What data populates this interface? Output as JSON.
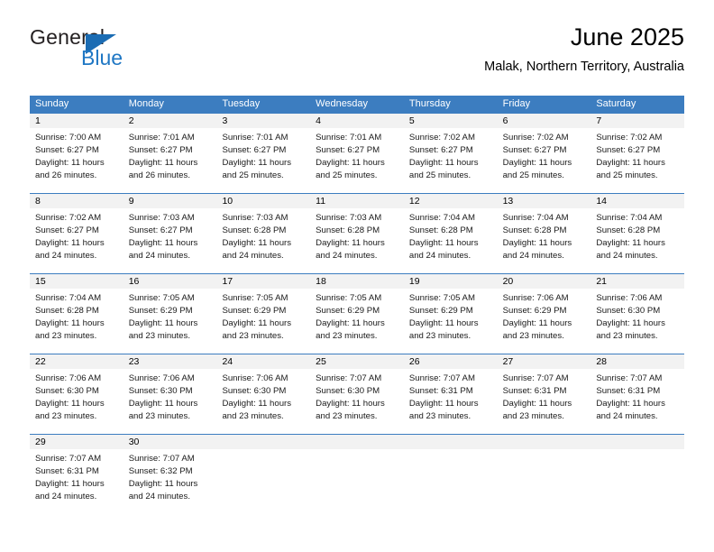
{
  "brand": {
    "name_top": "General",
    "name_bottom": "Blue",
    "accent_color": "#1b6cb3",
    "flag_icon": "triangle-flag-icon"
  },
  "header": {
    "title": "June 2025",
    "subtitle": "Malak, Northern Territory, Australia"
  },
  "calendar": {
    "header_bg": "#3c7dc0",
    "day_band_bg": "#f2f2f2",
    "weekday_names": [
      "Sunday",
      "Monday",
      "Tuesday",
      "Wednesday",
      "Thursday",
      "Friday",
      "Saturday"
    ],
    "weeks": [
      {
        "days": [
          {
            "num": "1",
            "sunrise": "Sunrise: 7:00 AM",
            "sunset": "Sunset: 6:27 PM",
            "daylight1": "Daylight: 11 hours",
            "daylight2": "and 26 minutes."
          },
          {
            "num": "2",
            "sunrise": "Sunrise: 7:01 AM",
            "sunset": "Sunset: 6:27 PM",
            "daylight1": "Daylight: 11 hours",
            "daylight2": "and 26 minutes."
          },
          {
            "num": "3",
            "sunrise": "Sunrise: 7:01 AM",
            "sunset": "Sunset: 6:27 PM",
            "daylight1": "Daylight: 11 hours",
            "daylight2": "and 25 minutes."
          },
          {
            "num": "4",
            "sunrise": "Sunrise: 7:01 AM",
            "sunset": "Sunset: 6:27 PM",
            "daylight1": "Daylight: 11 hours",
            "daylight2": "and 25 minutes."
          },
          {
            "num": "5",
            "sunrise": "Sunrise: 7:02 AM",
            "sunset": "Sunset: 6:27 PM",
            "daylight1": "Daylight: 11 hours",
            "daylight2": "and 25 minutes."
          },
          {
            "num": "6",
            "sunrise": "Sunrise: 7:02 AM",
            "sunset": "Sunset: 6:27 PM",
            "daylight1": "Daylight: 11 hours",
            "daylight2": "and 25 minutes."
          },
          {
            "num": "7",
            "sunrise": "Sunrise: 7:02 AM",
            "sunset": "Sunset: 6:27 PM",
            "daylight1": "Daylight: 11 hours",
            "daylight2": "and 25 minutes."
          }
        ]
      },
      {
        "days": [
          {
            "num": "8",
            "sunrise": "Sunrise: 7:02 AM",
            "sunset": "Sunset: 6:27 PM",
            "daylight1": "Daylight: 11 hours",
            "daylight2": "and 24 minutes."
          },
          {
            "num": "9",
            "sunrise": "Sunrise: 7:03 AM",
            "sunset": "Sunset: 6:27 PM",
            "daylight1": "Daylight: 11 hours",
            "daylight2": "and 24 minutes."
          },
          {
            "num": "10",
            "sunrise": "Sunrise: 7:03 AM",
            "sunset": "Sunset: 6:28 PM",
            "daylight1": "Daylight: 11 hours",
            "daylight2": "and 24 minutes."
          },
          {
            "num": "11",
            "sunrise": "Sunrise: 7:03 AM",
            "sunset": "Sunset: 6:28 PM",
            "daylight1": "Daylight: 11 hours",
            "daylight2": "and 24 minutes."
          },
          {
            "num": "12",
            "sunrise": "Sunrise: 7:04 AM",
            "sunset": "Sunset: 6:28 PM",
            "daylight1": "Daylight: 11 hours",
            "daylight2": "and 24 minutes."
          },
          {
            "num": "13",
            "sunrise": "Sunrise: 7:04 AM",
            "sunset": "Sunset: 6:28 PM",
            "daylight1": "Daylight: 11 hours",
            "daylight2": "and 24 minutes."
          },
          {
            "num": "14",
            "sunrise": "Sunrise: 7:04 AM",
            "sunset": "Sunset: 6:28 PM",
            "daylight1": "Daylight: 11 hours",
            "daylight2": "and 24 minutes."
          }
        ]
      },
      {
        "days": [
          {
            "num": "15",
            "sunrise": "Sunrise: 7:04 AM",
            "sunset": "Sunset: 6:28 PM",
            "daylight1": "Daylight: 11 hours",
            "daylight2": "and 23 minutes."
          },
          {
            "num": "16",
            "sunrise": "Sunrise: 7:05 AM",
            "sunset": "Sunset: 6:29 PM",
            "daylight1": "Daylight: 11 hours",
            "daylight2": "and 23 minutes."
          },
          {
            "num": "17",
            "sunrise": "Sunrise: 7:05 AM",
            "sunset": "Sunset: 6:29 PM",
            "daylight1": "Daylight: 11 hours",
            "daylight2": "and 23 minutes."
          },
          {
            "num": "18",
            "sunrise": "Sunrise: 7:05 AM",
            "sunset": "Sunset: 6:29 PM",
            "daylight1": "Daylight: 11 hours",
            "daylight2": "and 23 minutes."
          },
          {
            "num": "19",
            "sunrise": "Sunrise: 7:05 AM",
            "sunset": "Sunset: 6:29 PM",
            "daylight1": "Daylight: 11 hours",
            "daylight2": "and 23 minutes."
          },
          {
            "num": "20",
            "sunrise": "Sunrise: 7:06 AM",
            "sunset": "Sunset: 6:29 PM",
            "daylight1": "Daylight: 11 hours",
            "daylight2": "and 23 minutes."
          },
          {
            "num": "21",
            "sunrise": "Sunrise: 7:06 AM",
            "sunset": "Sunset: 6:30 PM",
            "daylight1": "Daylight: 11 hours",
            "daylight2": "and 23 minutes."
          }
        ]
      },
      {
        "days": [
          {
            "num": "22",
            "sunrise": "Sunrise: 7:06 AM",
            "sunset": "Sunset: 6:30 PM",
            "daylight1": "Daylight: 11 hours",
            "daylight2": "and 23 minutes."
          },
          {
            "num": "23",
            "sunrise": "Sunrise: 7:06 AM",
            "sunset": "Sunset: 6:30 PM",
            "daylight1": "Daylight: 11 hours",
            "daylight2": "and 23 minutes."
          },
          {
            "num": "24",
            "sunrise": "Sunrise: 7:06 AM",
            "sunset": "Sunset: 6:30 PM",
            "daylight1": "Daylight: 11 hours",
            "daylight2": "and 23 minutes."
          },
          {
            "num": "25",
            "sunrise": "Sunrise: 7:07 AM",
            "sunset": "Sunset: 6:30 PM",
            "daylight1": "Daylight: 11 hours",
            "daylight2": "and 23 minutes."
          },
          {
            "num": "26",
            "sunrise": "Sunrise: 7:07 AM",
            "sunset": "Sunset: 6:31 PM",
            "daylight1": "Daylight: 11 hours",
            "daylight2": "and 23 minutes."
          },
          {
            "num": "27",
            "sunrise": "Sunrise: 7:07 AM",
            "sunset": "Sunset: 6:31 PM",
            "daylight1": "Daylight: 11 hours",
            "daylight2": "and 23 minutes."
          },
          {
            "num": "28",
            "sunrise": "Sunrise: 7:07 AM",
            "sunset": "Sunset: 6:31 PM",
            "daylight1": "Daylight: 11 hours",
            "daylight2": "and 24 minutes."
          }
        ]
      },
      {
        "days": [
          {
            "num": "29",
            "sunrise": "Sunrise: 7:07 AM",
            "sunset": "Sunset: 6:31 PM",
            "daylight1": "Daylight: 11 hours",
            "daylight2": "and 24 minutes."
          },
          {
            "num": "30",
            "sunrise": "Sunrise: 7:07 AM",
            "sunset": "Sunset: 6:32 PM",
            "daylight1": "Daylight: 11 hours",
            "daylight2": "and 24 minutes."
          },
          {
            "num": "",
            "sunrise": "",
            "sunset": "",
            "daylight1": "",
            "daylight2": ""
          },
          {
            "num": "",
            "sunrise": "",
            "sunset": "",
            "daylight1": "",
            "daylight2": ""
          },
          {
            "num": "",
            "sunrise": "",
            "sunset": "",
            "daylight1": "",
            "daylight2": ""
          },
          {
            "num": "",
            "sunrise": "",
            "sunset": "",
            "daylight1": "",
            "daylight2": ""
          },
          {
            "num": "",
            "sunrise": "",
            "sunset": "",
            "daylight1": "",
            "daylight2": ""
          }
        ]
      }
    ]
  }
}
